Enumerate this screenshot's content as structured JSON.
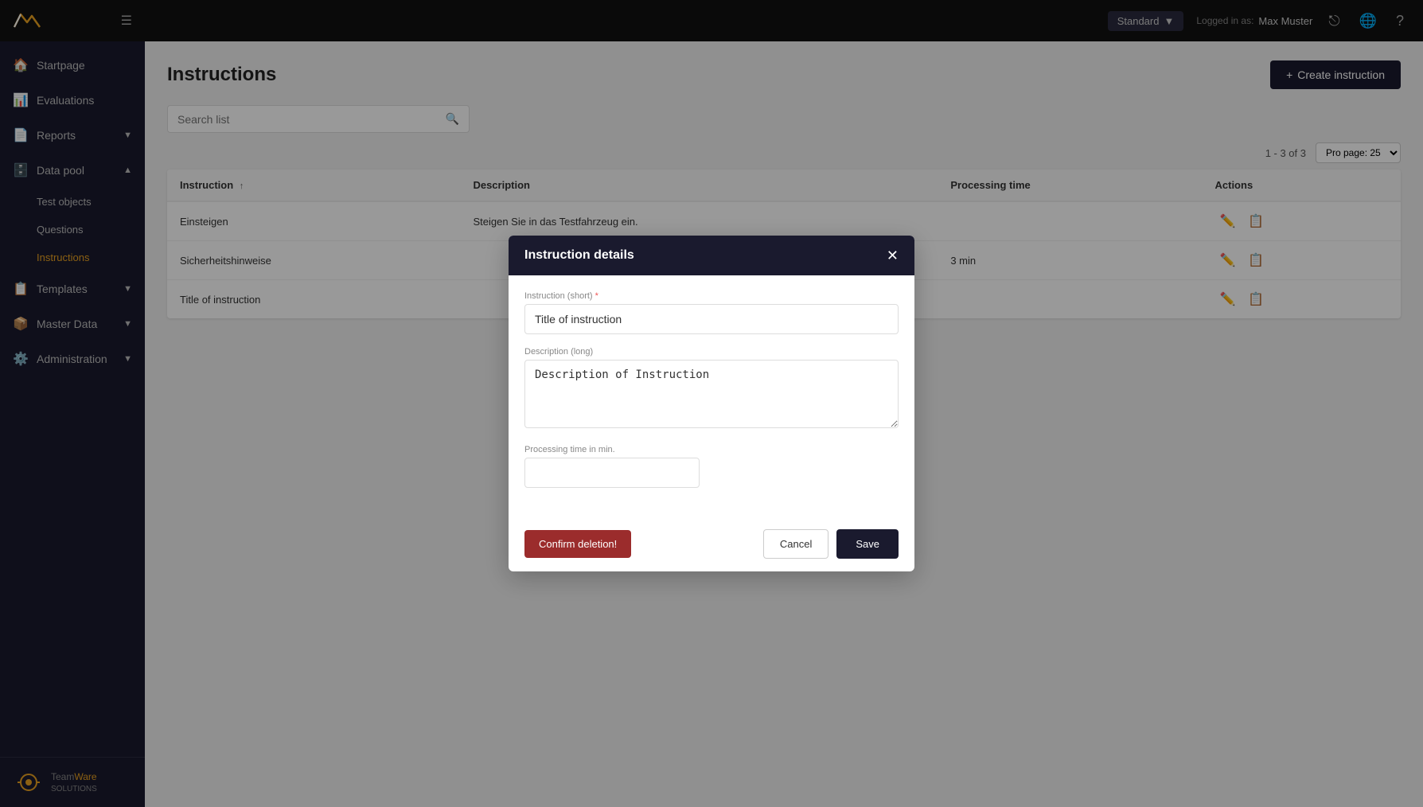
{
  "app": {
    "logo_text": "Team Ware",
    "logo_subtitle": "SOLUTIONS"
  },
  "topbar": {
    "dropdown_label": "Standard",
    "logged_in_label": "Logged in as:",
    "username": "Max Muster"
  },
  "sidebar": {
    "items": [
      {
        "id": "startpage",
        "label": "Startpage",
        "icon": "🏠",
        "active": false
      },
      {
        "id": "evaluations",
        "label": "Evaluations",
        "icon": "📊",
        "active": false
      },
      {
        "id": "reports",
        "label": "Reports",
        "icon": "📄",
        "active": false,
        "hasChevron": true
      },
      {
        "id": "data-pool",
        "label": "Data pool",
        "icon": "🗄️",
        "active": false,
        "hasChevron": true,
        "expanded": true
      },
      {
        "id": "templates",
        "label": "Templates",
        "icon": "📋",
        "active": false,
        "hasChevron": true
      },
      {
        "id": "master-data",
        "label": "Master Data",
        "icon": "📦",
        "active": false,
        "hasChevron": true
      },
      {
        "id": "administration",
        "label": "Administration",
        "icon": "⚙️",
        "active": false,
        "hasChevron": true
      }
    ],
    "sub_items": [
      {
        "id": "test-objects",
        "label": "Test objects"
      },
      {
        "id": "questions",
        "label": "Questions"
      },
      {
        "id": "instructions",
        "label": "Instructions",
        "active": true
      }
    ]
  },
  "page": {
    "title": "Instructions",
    "create_button_label": "Create instruction",
    "search_placeholder": "Search list",
    "results_text": "1 - 3 of 3",
    "per_page_label": "Pro page: 25"
  },
  "table": {
    "columns": [
      {
        "id": "instruction",
        "label": "Instruction",
        "sortable": true
      },
      {
        "id": "description",
        "label": "Description",
        "sortable": false
      },
      {
        "id": "processing_time",
        "label": "Processing time",
        "sortable": false
      },
      {
        "id": "actions",
        "label": "Actions",
        "sortable": false
      }
    ],
    "rows": [
      {
        "instruction": "Einsteigen",
        "description": "Steigen Sie in das Testfahrzeug ein.",
        "processing_time": ""
      },
      {
        "instruction": "Sicherheitshinweise",
        "description": "",
        "processing_time": "3 min"
      },
      {
        "instruction": "Title of instruction",
        "description": "",
        "processing_time": ""
      }
    ]
  },
  "modal": {
    "title": "Instruction details",
    "fields": {
      "instruction_short_label": "Instruction (short)",
      "instruction_short_required": "*",
      "instruction_short_value": "Title of instruction",
      "description_long_label": "Description (long)",
      "description_long_value": "Description of Instruction",
      "processing_time_label": "Processing time in min.",
      "processing_time_value": ""
    },
    "buttons": {
      "confirm_deletion": "Confirm deletion!",
      "cancel": "Cancel",
      "save": "Save"
    }
  }
}
